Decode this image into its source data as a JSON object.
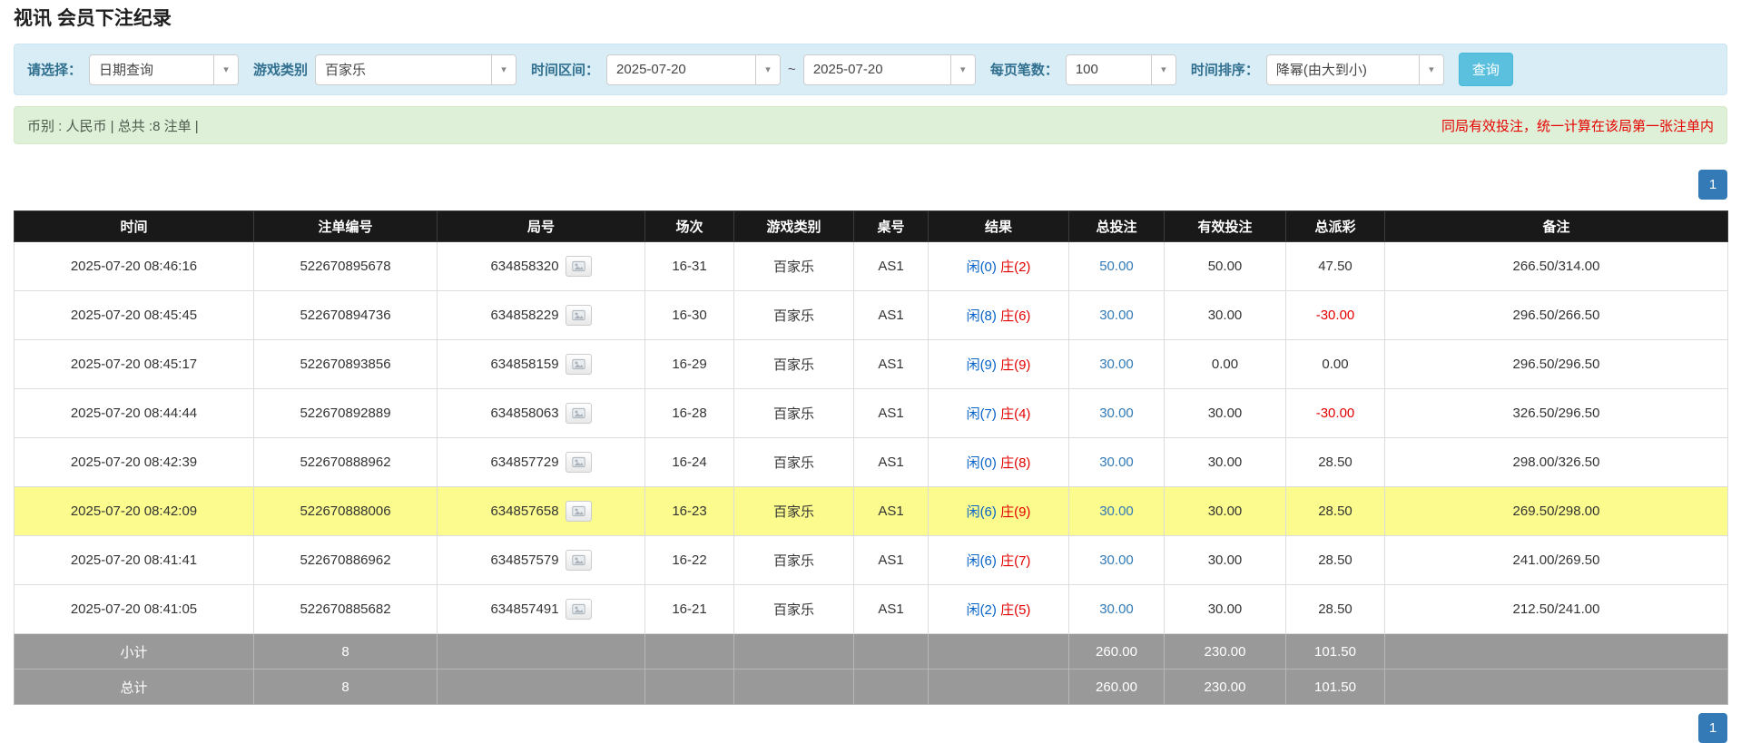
{
  "page": {
    "title": "视讯 会员下注纪录"
  },
  "filters": {
    "query_type_label": "请选择：",
    "query_type_value": "日期查询",
    "game_type_label": "游戏类别",
    "game_type_value": "百家乐",
    "time_range_label": "时间区间：",
    "date_from": "2025-07-20",
    "date_separator": "~",
    "date_to": "2025-07-20",
    "page_size_label": "每页笔数：",
    "page_size_value": "100",
    "sort_label": "时间排序：",
    "sort_value": "降幂(由大到小)",
    "search_button_label": "查询"
  },
  "summary": {
    "left_text": "币别 : 人民币 | 总共 :8 注单 |",
    "right_note": "同局有效投注，统一计算在该局第一张注单内"
  },
  "pagination": {
    "current_page": "1"
  },
  "table": {
    "headers": [
      "时间",
      "注单编号",
      "局号",
      "场次",
      "游戏类别",
      "桌号",
      "结果",
      "总投注",
      "有效投注",
      "总派彩",
      "备注"
    ],
    "rows": [
      {
        "time": "2025-07-20 08:46:16",
        "bet_id": "522670895678",
        "round_id": "634858320",
        "session": "16-31",
        "game": "百家乐",
        "table_no": "AS1",
        "result_player": "闲(0)",
        "result_banker": "庄(2)",
        "total_bet": "50.00",
        "valid_bet": "50.00",
        "payout": "47.50",
        "remark": "266.50/314.00",
        "highlighted": false
      },
      {
        "time": "2025-07-20 08:45:45",
        "bet_id": "522670894736",
        "round_id": "634858229",
        "session": "16-30",
        "game": "百家乐",
        "table_no": "AS1",
        "result_player": "闲(8)",
        "result_banker": "庄(6)",
        "total_bet": "30.00",
        "valid_bet": "30.00",
        "payout": "-30.00",
        "remark": "296.50/266.50",
        "highlighted": false
      },
      {
        "time": "2025-07-20 08:45:17",
        "bet_id": "522670893856",
        "round_id": "634858159",
        "session": "16-29",
        "game": "百家乐",
        "table_no": "AS1",
        "result_player": "闲(9)",
        "result_banker": "庄(9)",
        "total_bet": "30.00",
        "valid_bet": "0.00",
        "payout": "0.00",
        "remark": "296.50/296.50",
        "highlighted": false
      },
      {
        "time": "2025-07-20 08:44:44",
        "bet_id": "522670892889",
        "round_id": "634858063",
        "session": "16-28",
        "game": "百家乐",
        "table_no": "AS1",
        "result_player": "闲(7)",
        "result_banker": "庄(4)",
        "total_bet": "30.00",
        "valid_bet": "30.00",
        "payout": "-30.00",
        "remark": "326.50/296.50",
        "highlighted": false
      },
      {
        "time": "2025-07-20 08:42:39",
        "bet_id": "522670888962",
        "round_id": "634857729",
        "session": "16-24",
        "game": "百家乐",
        "table_no": "AS1",
        "result_player": "闲(0)",
        "result_banker": "庄(8)",
        "total_bet": "30.00",
        "valid_bet": "30.00",
        "payout": "28.50",
        "remark": "298.00/326.50",
        "highlighted": false
      },
      {
        "time": "2025-07-20 08:42:09",
        "bet_id": "522670888006",
        "round_id": "634857658",
        "session": "16-23",
        "game": "百家乐",
        "table_no": "AS1",
        "result_player": "闲(6)",
        "result_banker": "庄(9)",
        "total_bet": "30.00",
        "valid_bet": "30.00",
        "payout": "28.50",
        "remark": "269.50/298.00",
        "highlighted": true
      },
      {
        "time": "2025-07-20 08:41:41",
        "bet_id": "522670886962",
        "round_id": "634857579",
        "session": "16-22",
        "game": "百家乐",
        "table_no": "AS1",
        "result_player": "闲(6)",
        "result_banker": "庄(7)",
        "total_bet": "30.00",
        "valid_bet": "30.00",
        "payout": "28.50",
        "remark": "241.00/269.50",
        "highlighted": false
      },
      {
        "time": "2025-07-20 08:41:05",
        "bet_id": "522670885682",
        "round_id": "634857491",
        "session": "16-21",
        "game": "百家乐",
        "table_no": "AS1",
        "result_player": "闲(2)",
        "result_banker": "庄(5)",
        "total_bet": "30.00",
        "valid_bet": "30.00",
        "payout": "28.50",
        "remark": "212.50/241.00",
        "highlighted": false
      }
    ],
    "subtotal": {
      "label": "小计",
      "count": "8",
      "total_bet": "260.00",
      "valid_bet": "230.00",
      "payout": "101.50"
    },
    "total": {
      "label": "总计",
      "count": "8",
      "total_bet": "260.00",
      "valid_bet": "230.00",
      "payout": "101.50"
    }
  }
}
